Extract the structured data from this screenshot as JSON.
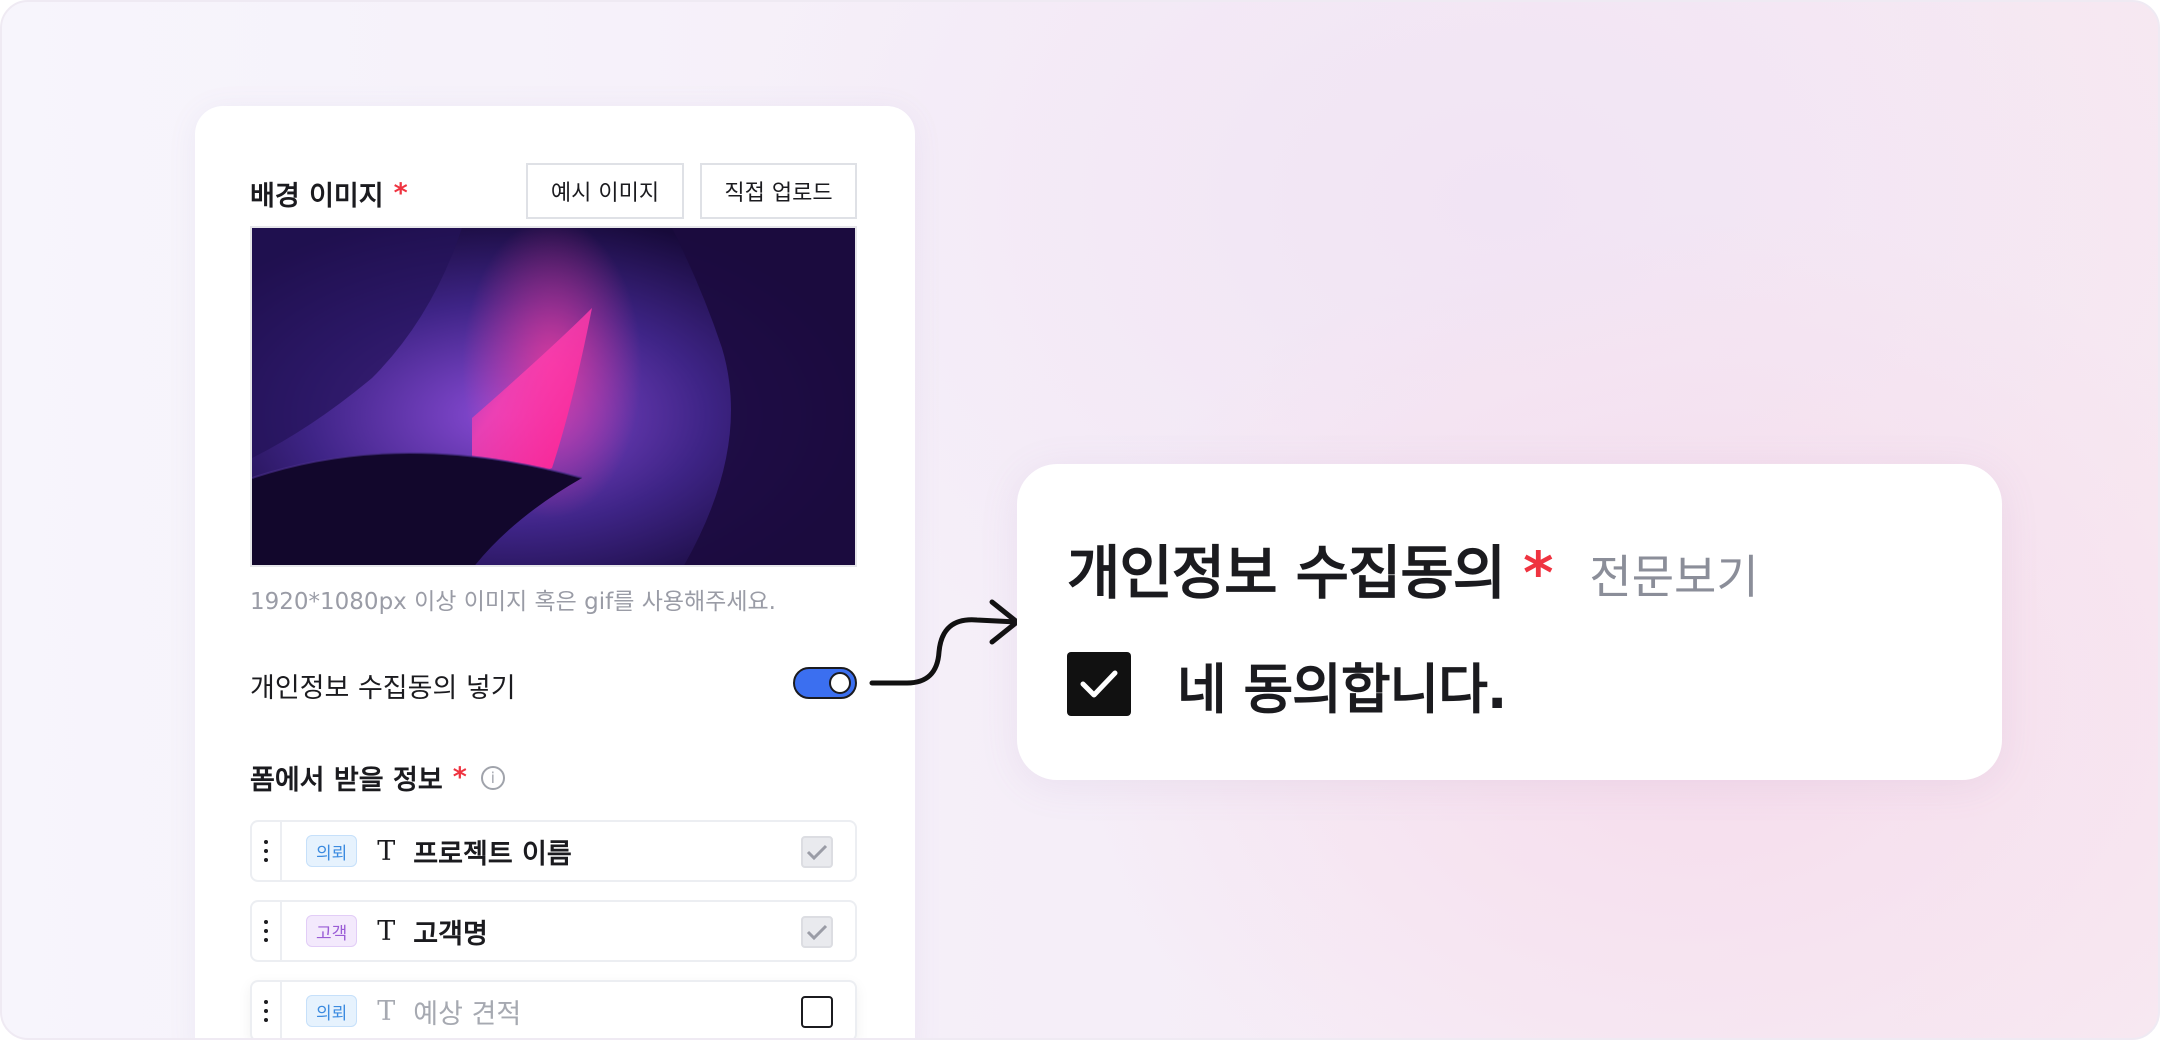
{
  "form": {
    "background_image": {
      "label": "배경 이미지",
      "required_mark": "*",
      "example_button": "예시 이미지",
      "upload_button": "직접 업로드",
      "hint": "1920*1080px 이상 이미지 혹은 gif를 사용해주세요."
    },
    "consent_toggle": {
      "label": "개인정보 수집동의 넣기",
      "enabled": true
    },
    "fields_section": {
      "label": "폼에서 받을 정보",
      "required_mark": "*",
      "info_icon": "i",
      "rows": [
        {
          "tag": "의뢰",
          "tag_color": "#3b8be0",
          "type_icon": "T",
          "label": "프로젝트 이름",
          "checked": true,
          "disabled": true
        },
        {
          "tag": "고객",
          "tag_color": "#9a5cd6",
          "type_icon": "T",
          "label": "고객명",
          "checked": true,
          "disabled": true
        },
        {
          "tag": "의뢰",
          "tag_color": "#3b8be0",
          "type_icon": "T",
          "label": "예상 견적",
          "checked": false,
          "disabled": false
        }
      ]
    }
  },
  "preview_card": {
    "title": "개인정보 수집동의",
    "required_mark": "*",
    "view_full_link": "전문보기",
    "agree_text": "네 동의합니다.",
    "agree_checked": true
  },
  "colors": {
    "accent": "#3b6ff0",
    "required": "#ef3340",
    "text": "#1b1b1f",
    "muted": "#9a9ca6"
  }
}
